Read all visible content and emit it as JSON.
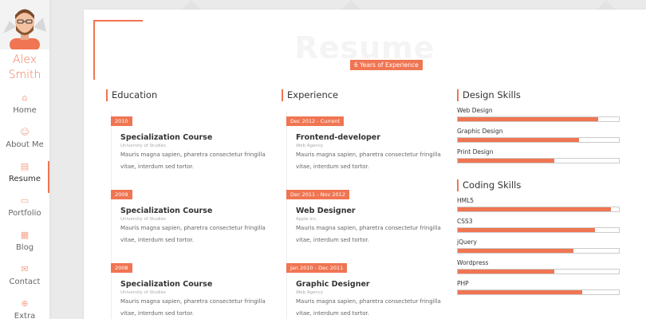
{
  "profile": {
    "first_name": "Alex",
    "last_name": "Smith"
  },
  "nav": [
    {
      "label": "Home",
      "icon": "home-icon",
      "active": false
    },
    {
      "label": "About Me",
      "icon": "user-icon",
      "active": false
    },
    {
      "label": "Resume",
      "icon": "briefcase-icon",
      "active": true
    },
    {
      "label": "Portfolio",
      "icon": "portfolio-icon",
      "active": false
    },
    {
      "label": "Blog",
      "icon": "blog-icon",
      "active": false
    },
    {
      "label": "Contact",
      "icon": "envelope-icon",
      "active": false
    },
    {
      "label": "Extra",
      "icon": "plus-circle-icon",
      "active": false
    }
  ],
  "hero": {
    "title": "Resume",
    "subtitle": "6 Years of Experience"
  },
  "education": {
    "heading": "Education",
    "entries": [
      {
        "date": "2010",
        "title": "Specialization Course",
        "org": "University of Studies",
        "desc1": "Mauris magna sapien, pharetra consectetur fringilla",
        "desc2": "vitae, interdum sed tortor."
      },
      {
        "date": "2009",
        "title": "Specialization Course",
        "org": "University of Studies",
        "desc1": "Mauris magna sapien, pharetra consectetur fringilla",
        "desc2": "vitae, interdum sed tortor."
      },
      {
        "date": "2008",
        "title": "Specialization Course",
        "org": "University of Studies",
        "desc1": "Mauris magna sapien, pharetra consectetur fringilla",
        "desc2": "vitae, interdum sed tortor."
      }
    ]
  },
  "experience": {
    "heading": "Experience",
    "entries": [
      {
        "date": "Dec 2012 - Current",
        "title": "Frontend-developer",
        "org": "Web Agency",
        "desc1": "Mauris magna sapien, pharetra consectetur fringilla",
        "desc2": "vitae, interdum sed tortor."
      },
      {
        "date": "Dec 2011 - Nov 2012",
        "title": "Web Designer",
        "org": "Apple Inc.",
        "desc1": "Mauris magna sapien, pharetra consectetur fringilla",
        "desc2": "vitae, interdum sed tortor."
      },
      {
        "date": "Jan 2010 - Dec 2011",
        "title": "Graphic Designer",
        "org": "Web Agency",
        "desc1": "Mauris magna sapien, pharetra consectetur fringilla",
        "desc2": "vitae, interdum sed tortor."
      }
    ]
  },
  "design_skills": {
    "heading": "Design Skills",
    "items": [
      {
        "name": "Web Design",
        "level": 0.87
      },
      {
        "name": "Graphic Design",
        "level": 0.75
      },
      {
        "name": "Print Design",
        "level": 0.6
      }
    ]
  },
  "coding_skills": {
    "heading": "Coding Skills",
    "items": [
      {
        "name": "HML5",
        "level": 0.95
      },
      {
        "name": "CSS3",
        "level": 0.85
      },
      {
        "name": "jQuery",
        "level": 0.72
      },
      {
        "name": "Wordpress",
        "level": 0.6
      },
      {
        "name": "PHP",
        "level": 0.77
      }
    ]
  },
  "colors": {
    "accent": "#f07552",
    "background": "#eaeaea",
    "card": "#ffffff"
  }
}
